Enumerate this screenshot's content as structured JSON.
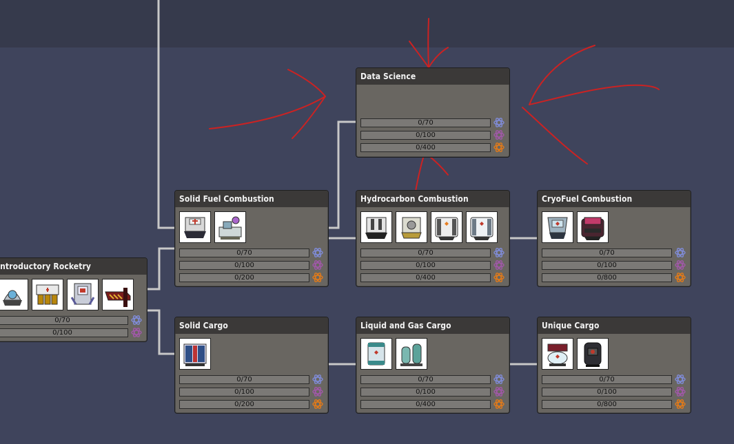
{
  "colors": {
    "background": "#3f445c",
    "top_band": "#363a4c",
    "node_body": "#696661",
    "node_header": "#3b3938",
    "connector": "#c8c8c8",
    "annotation_red": "#cc2222",
    "research_basic": "#7f8bd6",
    "research_advanced": "#a058a8",
    "research_orbital": "#e07a1a"
  },
  "research_icons": [
    "atom-icon-blue",
    "atom-icon-purple",
    "atom-icon-orange"
  ],
  "nodes": {
    "data_science": {
      "title": "Data Science",
      "progress": [
        "0/70",
        "0/100",
        "0/400"
      ]
    },
    "solid_fuel": {
      "title": "Solid Fuel Combustion",
      "unlocks": [
        "steam-engine-icon",
        "solid-oxidizer-tank-icon"
      ],
      "progress": [
        "0/70",
        "0/100",
        "0/200"
      ]
    },
    "hydrocarbon": {
      "title": "Hydrocarbon Combustion",
      "unlocks": [
        "petroleum-engine-icon",
        "small-petroleum-engine-icon",
        "liquid-fuel-tank-icon",
        "liquid-oxidizer-tank-icon"
      ],
      "progress": [
        "0/70",
        "0/100",
        "0/400"
      ]
    },
    "cryofuel": {
      "title": "CryoFuel Combustion",
      "unlocks": [
        "hydrogen-engine-icon",
        "hydrogen-tank-icon"
      ],
      "progress": [
        "0/70",
        "0/100",
        "0/800"
      ]
    },
    "intro_rocketry": {
      "title": "Introductory Rocketry",
      "unlocks": [
        "command-capsule-icon",
        "fuel-tank-icon",
        "research-module-icon",
        "gantry-icon"
      ],
      "progress": [
        "0/70",
        "0/100"
      ]
    },
    "solid_cargo": {
      "title": "Solid Cargo",
      "unlocks": [
        "cargo-bay-icon"
      ],
      "progress": [
        "0/70",
        "0/100",
        "0/200"
      ]
    },
    "liquid_gas_cargo": {
      "title": "Liquid and Gas Cargo",
      "unlocks": [
        "liquid-cargo-tank-icon",
        "gas-cargo-canister-icon"
      ],
      "progress": [
        "0/70",
        "0/100",
        "0/400"
      ]
    },
    "unique_cargo": {
      "title": "Unique Cargo",
      "unlocks": [
        "biological-cargo-bay-icon",
        "critter-cargo-bay-icon"
      ],
      "progress": [
        "0/70",
        "0/100",
        "0/800"
      ]
    }
  }
}
